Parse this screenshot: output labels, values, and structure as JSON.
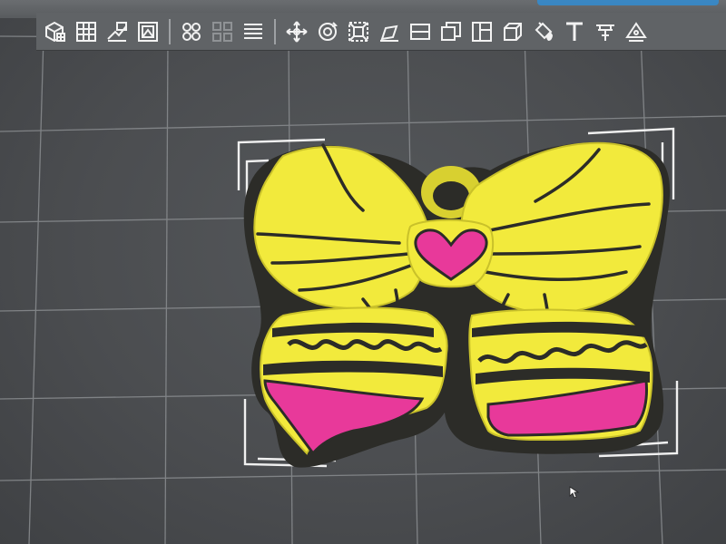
{
  "app": {
    "colors": {
      "viewport_bg": "#4b4d50",
      "grid_line": "#8a8d90",
      "toolbar_bg": "#606366",
      "icon_color": "#f2f2f2",
      "bow_yellow": "#f2ea3c",
      "bow_yellow_shade": "#c9c12a",
      "accent_pink": "#e8399a",
      "base_dark": "#2c2c28",
      "selection_bracket": "#f0f0f0"
    }
  },
  "toolbar": {
    "groups": [
      {
        "tools": [
          "add-object-icon",
          "grid-icon",
          "import-model-icon",
          "image-import-icon"
        ]
      },
      {
        "tools": [
          "four-circles-icon",
          "four-squares-icon",
          "layers-icon"
        ]
      },
      {
        "tools": [
          "move-icon",
          "rotate-icon",
          "scale-icon",
          "place-face-icon",
          "cut-icon",
          "arrange-icon",
          "mirror-icon",
          "solid-box-icon",
          "paint-icon",
          "text-icon",
          "support-icon",
          "seam-icon"
        ]
      }
    ]
  },
  "viewport": {
    "model_name_icon": "butterfly-bow-keychain-model"
  }
}
